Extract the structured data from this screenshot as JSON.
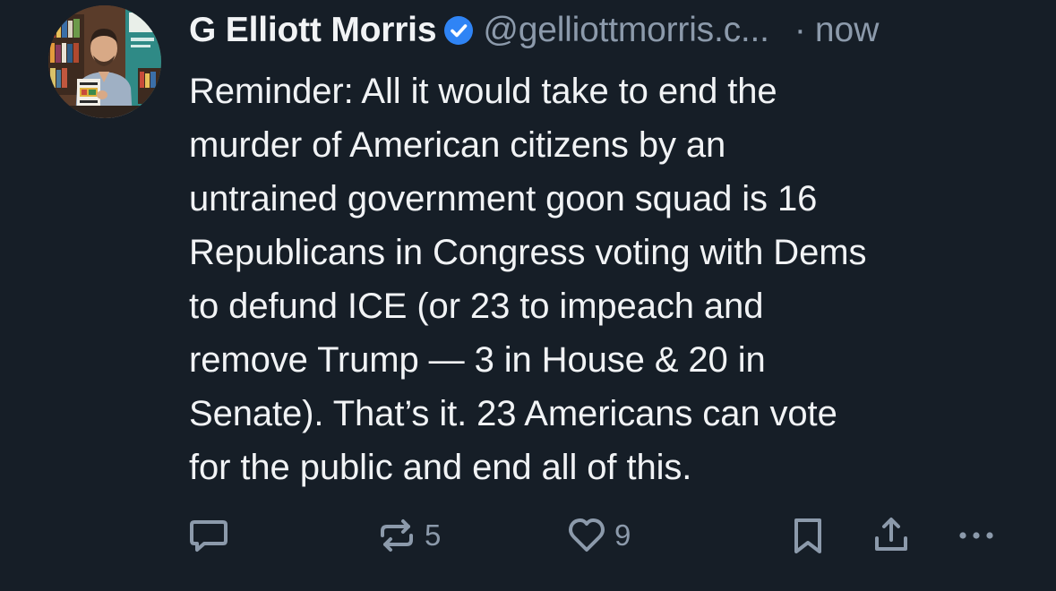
{
  "post": {
    "author": {
      "display_name": "G Elliott Morris",
      "handle": "@gelliottmorris.c...",
      "verified": true
    },
    "separator": "·",
    "time": "now",
    "text": "Reminder: All it would take to end the\nmurder of American citizens by an\nuntrained government goon squad is 16\nRepublicans in Congress voting with Dems\nto defund ICE (or 23 to impeach and\nremove Trump — 3 in House & 20 in\nSenate). That’s it. 23 Americans can vote\nfor the public and end all of this.",
    "actions": {
      "reply_count": "",
      "repost_count": "5",
      "like_count": "9"
    }
  },
  "colors": {
    "background": "#161e27",
    "text_primary": "#f1f3f5",
    "text_secondary": "#8c9aab",
    "verified_badge": "#2f84f5"
  },
  "icons": [
    "reply-icon",
    "repost-icon",
    "like-icon",
    "bookmark-icon",
    "share-icon",
    "more-icon",
    "verified-badge-icon"
  ]
}
